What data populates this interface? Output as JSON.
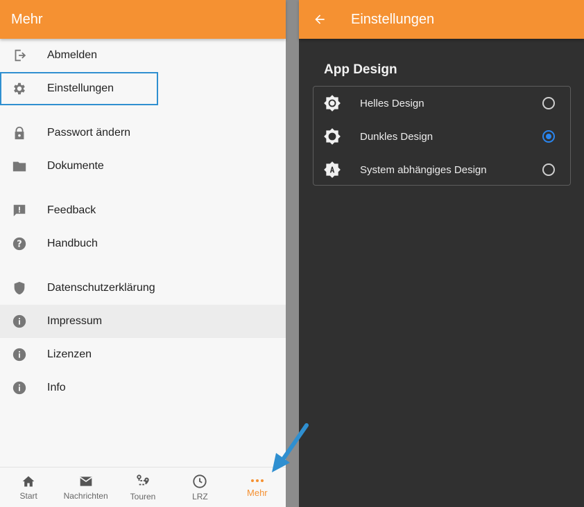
{
  "left": {
    "title": "Mehr",
    "menu": [
      {
        "label": "Abmelden",
        "icon": "logout-icon"
      },
      {
        "label": "Einstellungen",
        "icon": "gear-icon"
      },
      {
        "label": "Passwort ändern",
        "icon": "lock-icon"
      },
      {
        "label": "Dokumente",
        "icon": "folder-icon"
      },
      {
        "label": "Feedback",
        "icon": "feedback-icon"
      },
      {
        "label": "Handbuch",
        "icon": "help-icon"
      },
      {
        "label": "Datenschutzerklärung",
        "icon": "shield-icon"
      },
      {
        "label": "Impressum",
        "icon": "info-icon"
      },
      {
        "label": "Lizenzen",
        "icon": "info-icon"
      },
      {
        "label": "Info",
        "icon": "info-icon"
      }
    ],
    "bottom_nav": [
      {
        "label": "Start",
        "icon": "home-icon"
      },
      {
        "label": "Nachrichten",
        "icon": "mail-icon"
      },
      {
        "label": "Touren",
        "icon": "route-icon"
      },
      {
        "label": "LRZ",
        "icon": "clock-icon"
      },
      {
        "label": "Mehr",
        "icon": "more-dots-icon",
        "active": true
      }
    ]
  },
  "right": {
    "title": "Einstellungen",
    "section": "App Design",
    "options": [
      {
        "label": "Helles Design",
        "icon": "brightness-high-icon",
        "selected": false
      },
      {
        "label": "Dunkles Design",
        "icon": "brightness-low-icon",
        "selected": true
      },
      {
        "label": "System abhängiges Design",
        "icon": "brightness-auto-icon",
        "selected": false
      }
    ]
  },
  "colors": {
    "accent": "#f59132",
    "radio_selected": "#2a86f0",
    "annotation": "#2f8fd0"
  }
}
